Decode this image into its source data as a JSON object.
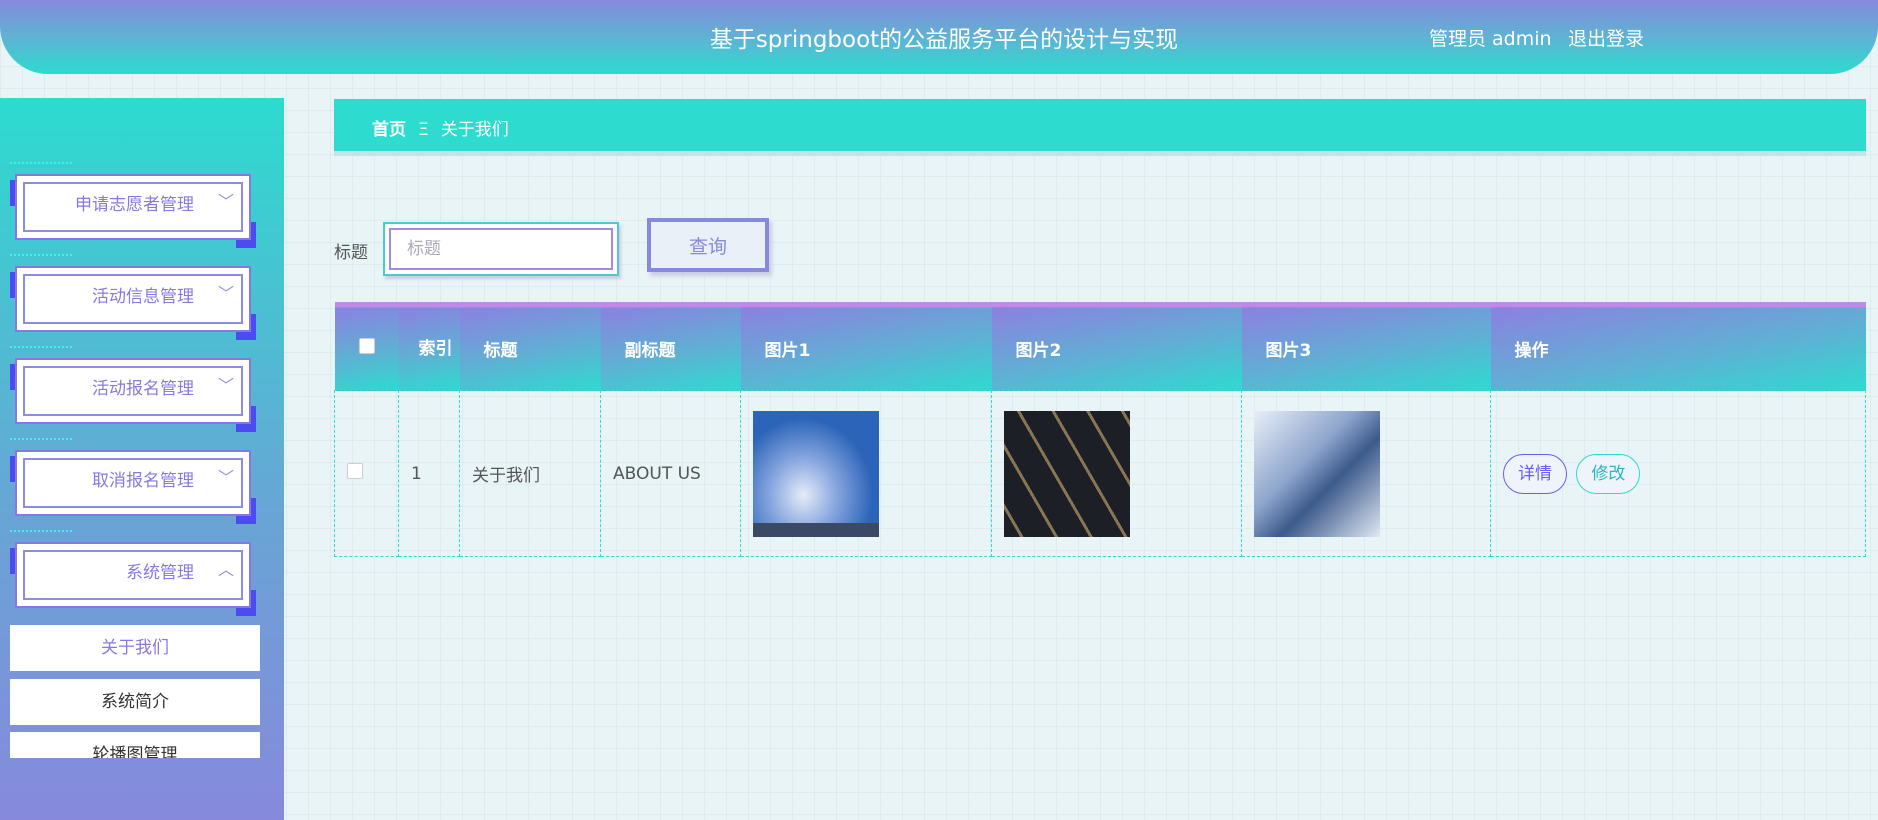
{
  "header": {
    "title": "基于springboot的公益服务平台的设计与实现",
    "user": "管理员 admin",
    "logout": "退出登录"
  },
  "sidebar": {
    "menus": [
      {
        "label": "申请志愿者管理",
        "icon": "chevron-down-icon"
      },
      {
        "label": "活动信息管理",
        "icon": "chevron-down-icon"
      },
      {
        "label": "活动报名管理",
        "icon": "chevron-down-icon"
      },
      {
        "label": "取消报名管理",
        "icon": "chevron-down-icon"
      },
      {
        "label": "系统管理",
        "icon": "chevron-up-icon"
      }
    ],
    "submenu": [
      {
        "label": "关于我们"
      },
      {
        "label": "系统简介"
      },
      {
        "label": "轮播图管理"
      }
    ]
  },
  "breadcrumb": {
    "home": "首页",
    "sep": "Ξ",
    "current": "关于我们"
  },
  "search": {
    "label": "标题",
    "placeholder": "标题",
    "value": "",
    "button": "查询"
  },
  "table": {
    "headers": [
      "索引",
      "标题",
      "副标题",
      "图片1",
      "图片2",
      "图片3",
      "操作"
    ],
    "rows": [
      {
        "index": "1",
        "title": "关于我们",
        "subtitle": "ABOUT US",
        "detail": "详情",
        "edit": "修改"
      }
    ]
  },
  "colors": {
    "accent": "#2ddbcf",
    "purple": "#8789dc"
  }
}
